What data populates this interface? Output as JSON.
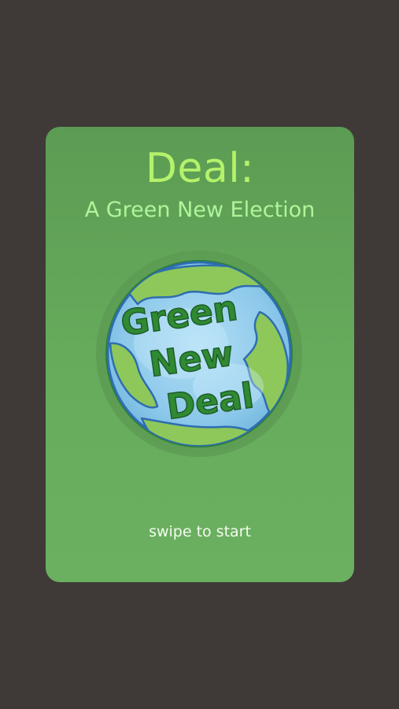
{
  "card": {
    "title": "Deal:",
    "subtitle": "A Green New Election",
    "hint": "swipe to start"
  },
  "logo": {
    "icon": "earth-globe-icon",
    "lines": [
      "Green",
      "New",
      "Deal"
    ]
  },
  "colors": {
    "background": "#3f3a37",
    "card": "#62a358",
    "title": "#b3f26a",
    "subtitle": "#b0f59a",
    "ocean": "#92cdec",
    "land": "#8ec85b",
    "logo_text": "#2f8a32"
  }
}
